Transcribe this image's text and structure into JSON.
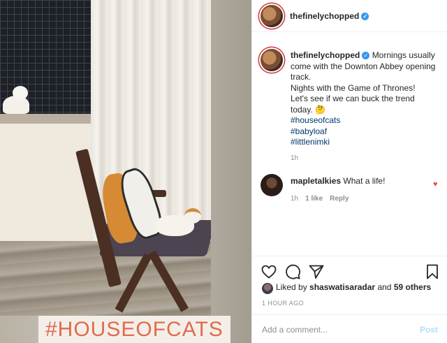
{
  "media": {
    "overlay_text": "#HOUSEOFCATS"
  },
  "header": {
    "username": "thefinelychopped",
    "verified": true
  },
  "caption": {
    "username": "thefinelychopped",
    "lines": [
      "Mornings usually",
      "come with the Downton Abbey opening",
      "track.",
      "Nights with the Game of Thrones!",
      "Let's see if we can buck the trend",
      "today. 🤔"
    ],
    "hashtags": [
      "#houseofcats",
      "#babyloaf",
      "#littlenimki"
    ],
    "time": "1h"
  },
  "comments": [
    {
      "username": "mapletalkies",
      "text": "What a life!",
      "time": "1h",
      "likes": "1 like",
      "reply": "Reply",
      "liked": true
    }
  ],
  "actions": {
    "icons": [
      "heart-icon",
      "comment-icon",
      "share-icon",
      "bookmark-icon"
    ]
  },
  "likes": {
    "prefix": "Liked by",
    "user": "shaswatisaradar",
    "conjunction": "and",
    "others": "59 others"
  },
  "timestamp": "1 HOUR AGO",
  "add_comment": {
    "placeholder": "Add a comment...",
    "post_label": "Post"
  },
  "colors": {
    "accent": "#3897f0",
    "hashtag": "#00376b",
    "like_red": "#ed4956",
    "muted": "#8e8e8e",
    "post_disabled": "#b2dffc"
  }
}
